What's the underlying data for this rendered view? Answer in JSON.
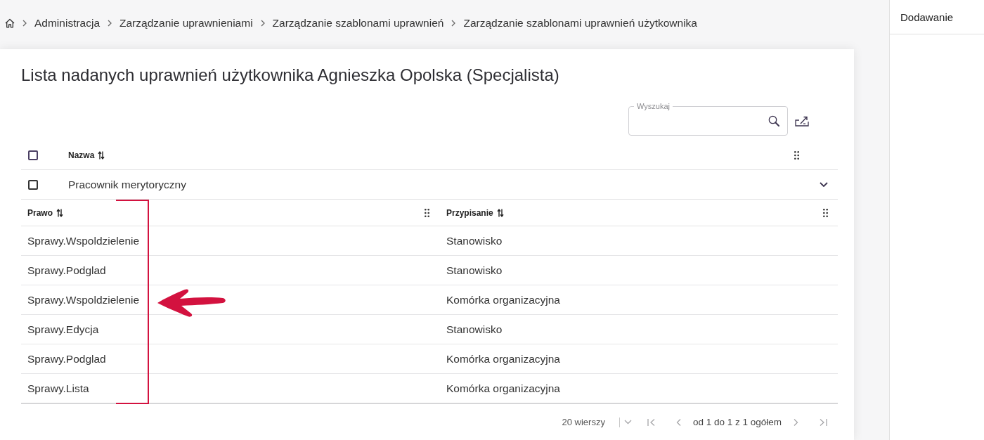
{
  "breadcrumbs": [
    {
      "label": "Administracja"
    },
    {
      "label": "Zarządzanie uprawnieniami"
    },
    {
      "label": "Zarządzanie szablonami uprawnień"
    },
    {
      "label": "Zarządzanie szablonami uprawnień użytkownika"
    }
  ],
  "card": {
    "title": "Lista nadanych uprawnień użytkownika Agnieszka Opolska (Specjalista)",
    "search": {
      "label": "Wyszukaj"
    }
  },
  "table": {
    "select_all": {
      "checked": false
    },
    "columns": [
      {
        "label": "Nazwa"
      }
    ],
    "groups": [
      {
        "name": "Pracownik merytoryczny",
        "checked": false,
        "expanded": true,
        "columns": [
          {
            "label": "Prawo",
            "bracketed": true
          },
          {
            "label": "Przypisanie",
            "bracketed": false
          }
        ],
        "rows": [
          {
            "cells": [
              "Sprawy.Wspoldzielenie",
              "Stanowisko"
            ],
            "arrow": false
          },
          {
            "cells": [
              "Sprawy.Podglad",
              "Stanowisko"
            ],
            "arrow": false
          },
          {
            "cells": [
              "Sprawy.Wspoldzielenie",
              "Komórka organizacyjna"
            ],
            "arrow": true
          },
          {
            "cells": [
              "Sprawy.Edycja",
              "Stanowisko"
            ],
            "arrow": false
          },
          {
            "cells": [
              "Sprawy.Podglad",
              "Komórka organizacyjna"
            ],
            "arrow": false
          },
          {
            "cells": [
              "Sprawy.Lista",
              "Komórka organizacyjna"
            ],
            "arrow": false
          }
        ]
      }
    ]
  },
  "pagination": {
    "rows_per_page": "20 wierszy",
    "range": "od 1 do 1 z 1 ogółem",
    "buttons": [
      {
        "kind": "first",
        "disabled": true
      },
      {
        "kind": "previous",
        "disabled": true
      },
      {
        "kind": "next",
        "disabled": true
      },
      {
        "kind": "last",
        "disabled": true
      }
    ]
  },
  "side_panel": {
    "title": "Dodawanie"
  }
}
